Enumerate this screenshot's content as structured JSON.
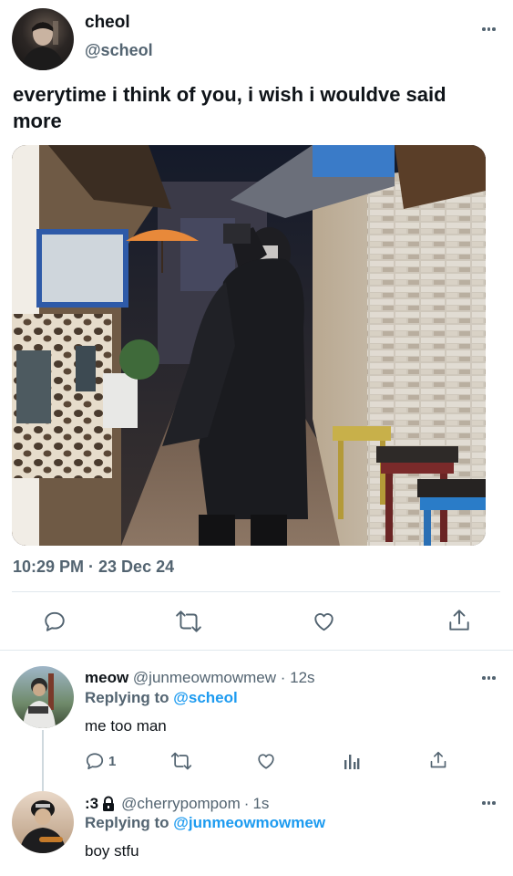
{
  "tweet": {
    "author_name": "cheol",
    "author_handle": "@scheol",
    "text": "everytime i think of you, i wish i wouldve said more",
    "timestamp": "10:29 PM · 23 Dec 24"
  },
  "reply1": {
    "name": "meow",
    "handle": "@junmeowmowmew",
    "time": "12s",
    "replying_label": "Replying to",
    "replying_to": "@scheol",
    "text": "me too man",
    "reply_count": "1"
  },
  "reply2": {
    "name": ":3",
    "handle": "@cherrypompom",
    "time": "1s",
    "replying_label": "Replying to",
    "replying_to": "@junmeowmowmew",
    "text": "boy stfu"
  },
  "colors": {
    "accent": "#1d9bf0",
    "secondary_text": "#536471",
    "divider": "#eff3f4"
  },
  "icons": [
    "more-icon",
    "reply-icon",
    "retweet-icon",
    "like-icon",
    "share-icon",
    "analytics-icon",
    "lock-icon"
  ]
}
